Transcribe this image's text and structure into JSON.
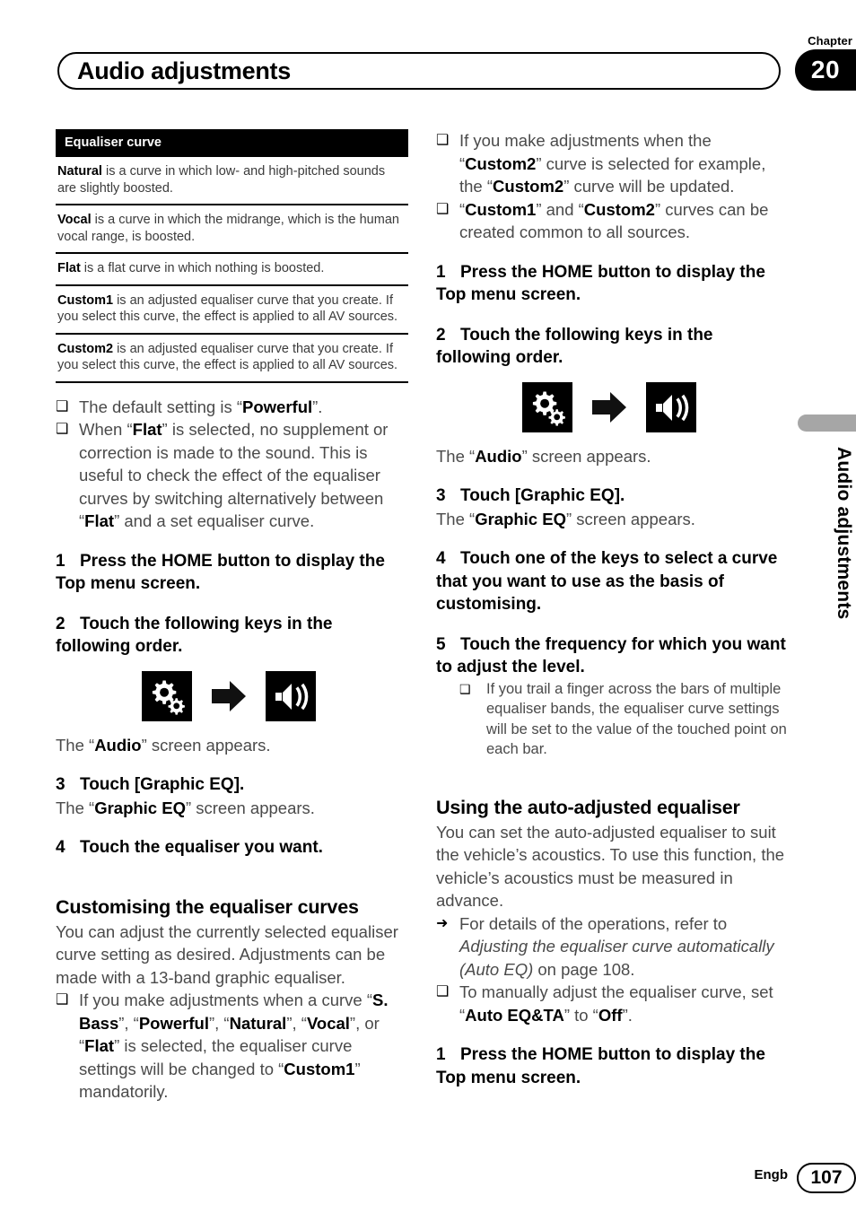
{
  "header": {
    "chapter_label": "Chapter",
    "chapter_number": "20",
    "title": "Audio adjustments"
  },
  "side_tab": {
    "label": "Audio adjustments"
  },
  "footer": {
    "language": "Engb",
    "page_number": "107"
  },
  "icons": {
    "settings": "gears-icon",
    "arrow": "right-arrow-icon",
    "audio": "speaker-icon"
  },
  "left_column": {
    "table": {
      "header": "Equaliser curve",
      "rows": [
        {
          "term": "Natural",
          "text": " is a curve in which low- and high-pitched sounds are slightly boosted."
        },
        {
          "term": "Vocal",
          "text": " is a curve in which the midrange, which is the human vocal range, is boosted."
        },
        {
          "term": "Flat",
          "text": " is a flat curve in which nothing is boosted."
        },
        {
          "term": "Custom1",
          "text": " is an adjusted equaliser curve that you create. If you select this curve, the effect is applied to all AV sources."
        },
        {
          "term": "Custom2",
          "text": " is an adjusted equaliser curve that you create. If you select this curve, the effect is applied to all AV sources."
        }
      ]
    },
    "note_1": "The default setting is “Powerful”.",
    "note_2": "When “Flat” is selected, no supplement or correction is made to the sound. This is useful to check the effect of the equaliser curves by switching alternatively between “Flat” and a set equaliser curve.",
    "step_1_num": "1",
    "step_1": "Press the HOME button to display the Top menu screen.",
    "step_2_num": "2",
    "step_2": "Touch the following keys in the following order.",
    "audio_screen_appears": "The “Audio” screen appears.",
    "step_3_num": "3",
    "step_3": "Touch [Graphic EQ].",
    "graphic_eq_appears": "The “Graphic EQ” screen appears.",
    "step_4_num": "4",
    "step_4": "Touch the equaliser you want.",
    "section_heading": "Customising the equaliser curves",
    "section_intro": "You can adjust the currently selected equaliser curve setting as desired. Adjustments can be made with a 13-band graphic equaliser.",
    "section_note": "If you make adjustments when a curve “S. Bass”, “Powerful”, “Natural”, “Vocal”, or “Flat” is selected, the equaliser curve settings will be changed to “Custom1” mandatorily."
  },
  "right_column": {
    "note_1": "If you make adjustments when the “Custom2” curve is selected for example, the “Custom2” curve will be updated.",
    "note_2": "“Custom1” and “Custom2” curves can be created common to all sources.",
    "step_1_num": "1",
    "step_1": "Press the HOME button to display the Top menu screen.",
    "step_2_num": "2",
    "step_2": "Touch the following keys in the following order.",
    "audio_screen_appears": "The “Audio” screen appears.",
    "step_3_num": "3",
    "step_3": "Touch [Graphic EQ].",
    "graphic_eq_appears": "The “Graphic EQ” screen appears.",
    "step_4_num": "4",
    "step_4": "Touch one of the keys to select a curve that you want to use as the basis of customising.",
    "step_5_num": "5",
    "step_5": "Touch the frequency for which you want to adjust the level.",
    "step_5_note": "If you trail a finger across the bars of multiple equaliser bands, the equaliser curve settings will be set to the value of the touched point on each bar.",
    "section_heading": "Using the auto-adjusted equaliser",
    "section_intro": "You can set the auto-adjusted equaliser to suit the vehicle’s acoustics. To use this function, the vehicle’s acoustics must be measured in advance.",
    "ref_note": "For details of the operations, refer to Adjusting the equaliser curve automatically (Auto EQ) on page 108.",
    "ref_note_plain_a": "For details of the operations, refer to ",
    "ref_note_italic": "Adjusting the equaliser curve automatically (Auto EQ)",
    "ref_note_plain_b": " on page 108.",
    "manual_note": "To manually adjust the equaliser curve, set “Auto EQ&TA” to “Off”.",
    "final_step_num": "1",
    "final_step": "Press the HOME button to display the Top menu screen."
  }
}
